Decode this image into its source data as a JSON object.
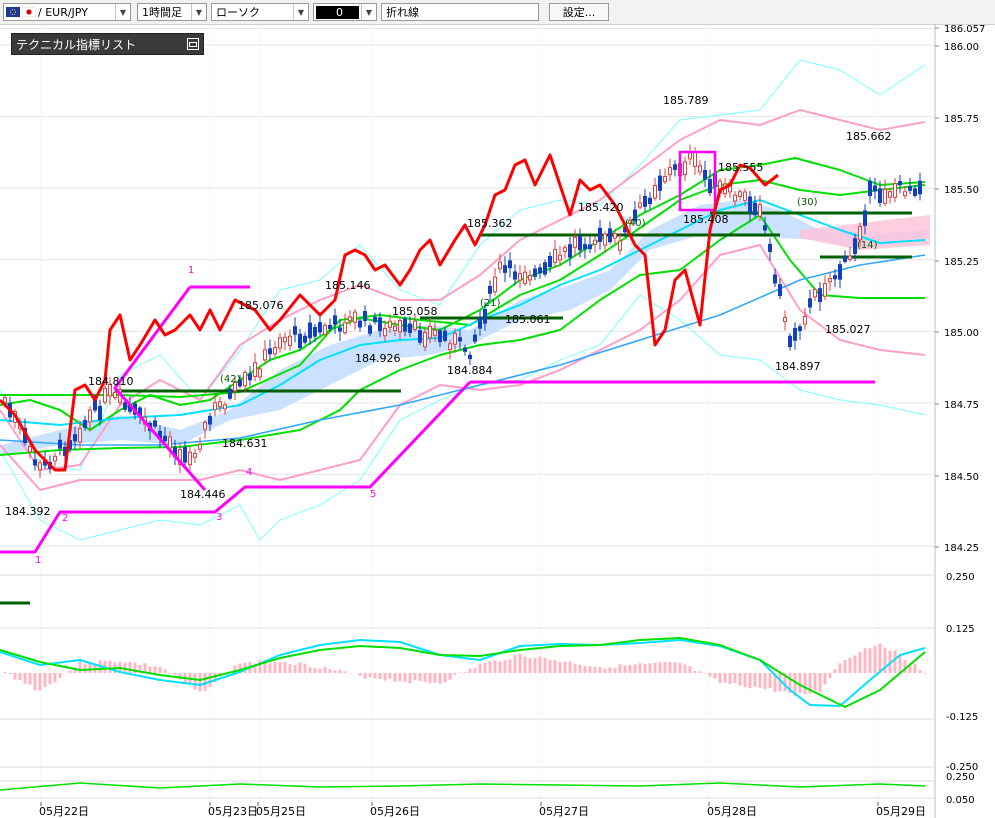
{
  "toolbar": {
    "symbol": "/ EUR/JPY",
    "timeframe": "1時間足",
    "chart_style": "ローソク",
    "color_value": "0",
    "line_label": "折れ線",
    "settings_label": "設定..."
  },
  "panel": {
    "title": "テクニカル指標リスト"
  },
  "colors": {
    "candle_up": "#e04040",
    "candle_down": "#1040c0",
    "zigzag": "#ff00ff",
    "red_line": "#ff0000",
    "bollinger_outer": "#90ffff",
    "bollinger_inner": "#ff9ec8",
    "ma_green": "#00e000",
    "ma_cyan": "#00e0ff",
    "ma_blue": "#30a8ff",
    "kumo": "#b8d8ff",
    "hline": "#006000"
  },
  "chart_data": {
    "type": "candlestick",
    "price_axis": {
      "labels": [
        "186.057",
        "186.00",
        "185.75",
        "185.50",
        "185.25",
        "185.00",
        "184.75",
        "184.50",
        "184.25"
      ],
      "range": [
        184.19,
        186.06
      ]
    },
    "dates": [
      "05月22日",
      "05月23日",
      "05月25日",
      "05月26日",
      "05月27日",
      "05月28日",
      "05月29日"
    ],
    "price_labels": [
      {
        "text": "184.392",
        "price": 184.392
      },
      {
        "text": "184.810",
        "price": 184.81
      },
      {
        "text": "184.446",
        "price": 184.446
      },
      {
        "text": "184.631",
        "price": 184.631
      },
      {
        "text": "185.076",
        "price": 185.076
      },
      {
        "text": "185.146",
        "price": 185.146
      },
      {
        "text": "184.926",
        "price": 184.926
      },
      {
        "text": "185.058",
        "price": 185.058
      },
      {
        "text": "185.061",
        "price": 185.061
      },
      {
        "text": "184.884",
        "price": 184.884
      },
      {
        "text": "185.362",
        "price": 185.362
      },
      {
        "text": "185.420",
        "price": 185.42
      },
      {
        "text": "185.789",
        "price": 185.789
      },
      {
        "text": "185.555",
        "price": 185.555
      },
      {
        "text": "185.408",
        "price": 185.408
      },
      {
        "text": "184.897",
        "price": 184.897
      },
      {
        "text": "185.027",
        "price": 185.027
      },
      {
        "text": "185.662",
        "price": 185.662
      }
    ],
    "period_labels": [
      "(42)",
      "(21)",
      "(40)",
      "(30)",
      "(14)"
    ],
    "wave_labels": [
      "1",
      "1",
      "2",
      "3",
      "4",
      "5"
    ],
    "macd_axis": {
      "labels": [
        "0.250",
        "0.125",
        "-0.125"
      ],
      "range": [
        -0.19,
        0.27
      ]
    },
    "rsi_axis": {
      "labels": [
        "-0.250",
        "0.250",
        "0.050"
      ]
    }
  }
}
